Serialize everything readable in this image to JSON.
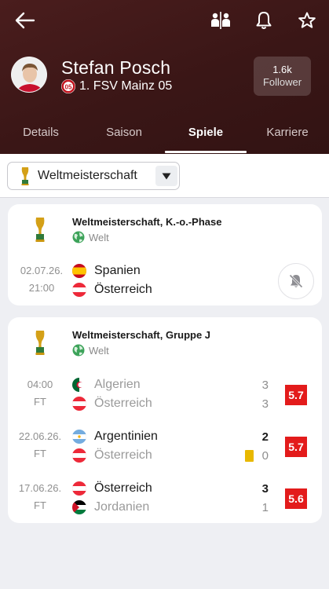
{
  "player": {
    "name": "Stefan Posch",
    "club": "1. FSV Mainz 05"
  },
  "follower": {
    "count": "1.6k",
    "label": "Follower"
  },
  "tabs": [
    {
      "label": "Details"
    },
    {
      "label": "Saison"
    },
    {
      "label": "Spiele",
      "active": true
    },
    {
      "label": "Karriere"
    }
  ],
  "filter": {
    "selected": "Weltmeisterschaft"
  },
  "cards": [
    {
      "title": "Weltmeisterschaft, K.-o.-Phase",
      "region": "Welt",
      "matches": [
        {
          "date": "02.07.26.",
          "time": "21:00",
          "home": "Spanien",
          "away": "Österreich"
        }
      ]
    },
    {
      "title": "Weltmeisterschaft, Gruppe J",
      "region": "Welt",
      "matches": [
        {
          "date": "04:00",
          "time": "FT",
          "home": "Algerien",
          "away": "Österreich",
          "home_score": "3",
          "away_score": "3",
          "rating": "5.7"
        },
        {
          "date": "22.06.26.",
          "time": "FT",
          "home": "Argentinien",
          "away": "Österreich",
          "home_score": "2",
          "away_score": "0",
          "rating": "5.7",
          "yellow_card": true
        },
        {
          "date": "17.06.26.",
          "time": "FT",
          "home": "Österreich",
          "away": "Jordanien",
          "home_score": "3",
          "away_score": "1",
          "rating": "5.6"
        }
      ]
    }
  ],
  "colors": {
    "header_bg": "#3a1616",
    "rating_bg": "#e31b1b",
    "yellow_card": "#e8b800"
  }
}
